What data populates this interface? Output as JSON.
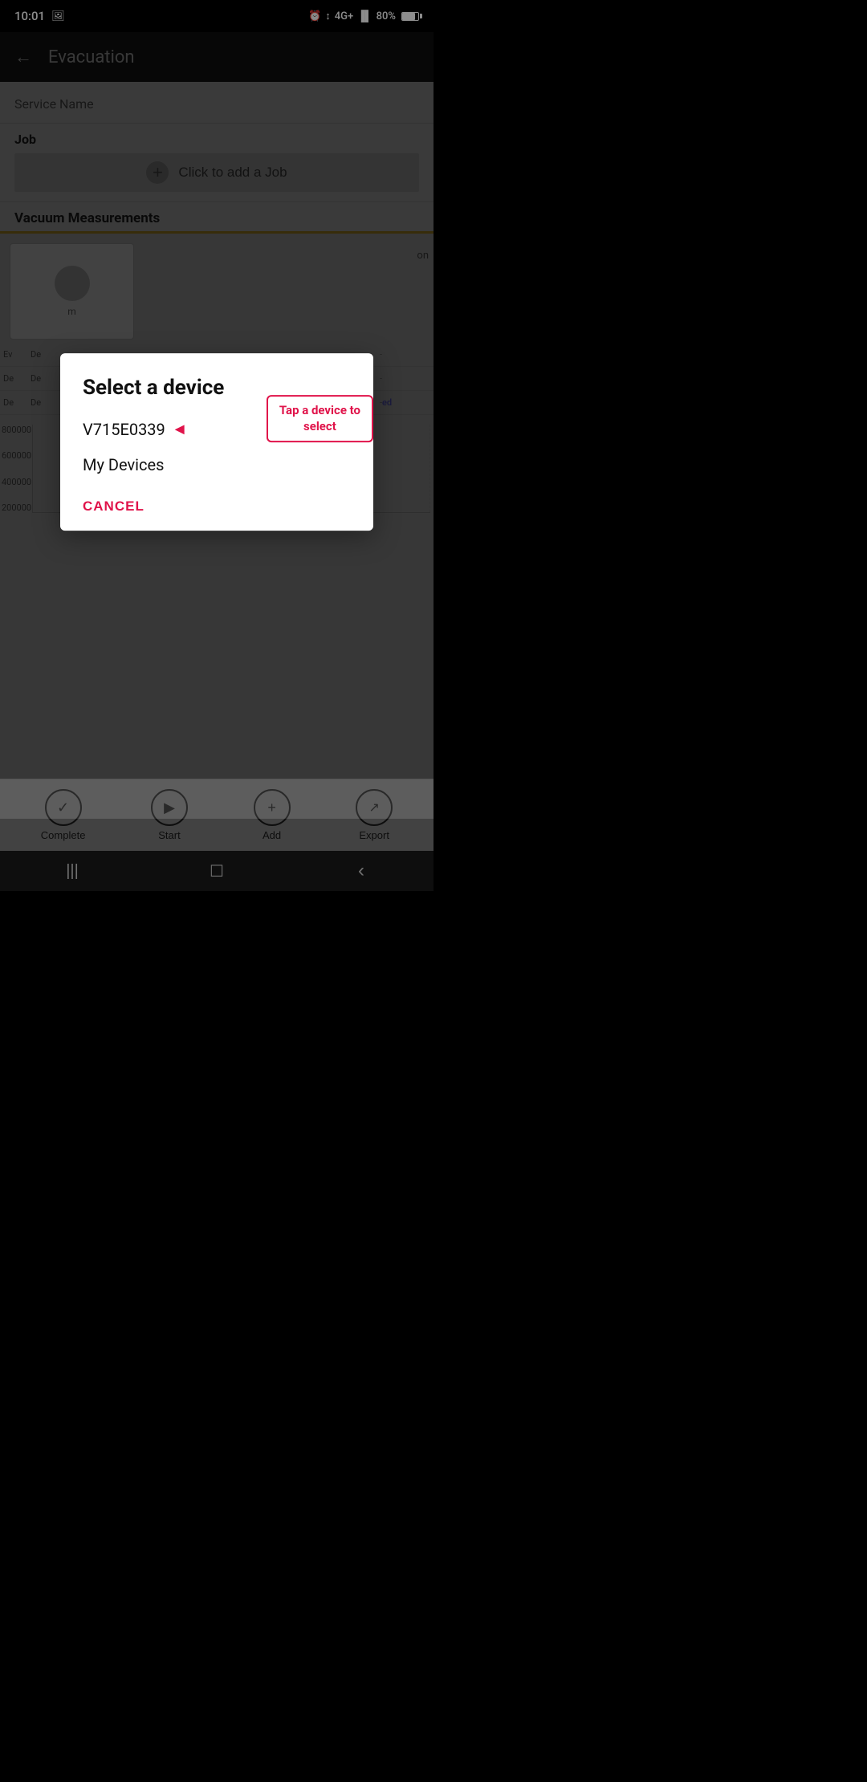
{
  "statusBar": {
    "time": "10:01",
    "battery": "80%",
    "signal": "4G+"
  },
  "appBar": {
    "title": "Evacuation",
    "backLabel": "←"
  },
  "content": {
    "serviceNameLabel": "Service Name",
    "jobLabel": "Job",
    "addJobLabel": "Click to add a Job",
    "vacuumLabel": "Vacuum Measurements",
    "chartYLabels": [
      "800000",
      "600000",
      "400000",
      "200000"
    ],
    "tableRows": [
      {
        "prefix": "Ev",
        "col1": "De",
        "col2": "-",
        "col3": "-",
        "highlight": ""
      },
      {
        "prefix": "De",
        "col1": "De",
        "col2": "-",
        "col3": "-",
        "highlight": ""
      },
      {
        "prefix": "De",
        "col1": "De",
        "col2": "-",
        "col3": "-",
        "highlight": "ed"
      }
    ]
  },
  "toolbar": {
    "completeLabel": "Complete",
    "startLabel": "Start",
    "addLabel": "Add",
    "exportLabel": "Export"
  },
  "dialog": {
    "title": "Select a device",
    "devices": [
      {
        "id": "V715E0339",
        "label": "V715E0339"
      },
      {
        "id": "my-devices",
        "label": "My Devices"
      }
    ],
    "annotation": "Tap a device to\nselect",
    "cancelLabel": "CANCEL"
  },
  "navBar": {
    "menuIcon": "|||",
    "homeIcon": "☐",
    "backIcon": "‹"
  }
}
